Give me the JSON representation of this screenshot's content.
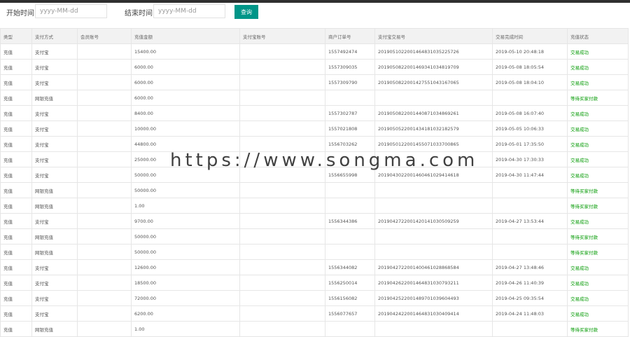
{
  "filter": {
    "start_label": "开始时间",
    "start_placeholder": "yyyy-MM-dd",
    "end_label": "结束时间",
    "end_placeholder": "yyyy-MM-dd",
    "query_button": "查询"
  },
  "table": {
    "headers": [
      "类型",
      "支付方式",
      "会员账号",
      "充值金额",
      "支付宝账号",
      "商户订单号",
      "支付宝交易号",
      "交易完成时间",
      "充值状态"
    ],
    "rows": [
      {
        "type": "充值",
        "method": "支付宝",
        "account": "",
        "amount": "15400.00",
        "alipay": "",
        "order": "1557492474",
        "trade": "2019051022001464831035225726",
        "time": "2019-05-10 20:48:18",
        "status": "交易成功",
        "status_kind": "ok"
      },
      {
        "type": "充值",
        "method": "支付宝",
        "account": "",
        "amount": "6000.00",
        "alipay": "",
        "order": "1557309035",
        "trade": "2019050822001469341034819709",
        "time": "2019-05-08 18:05:54",
        "status": "交易成功",
        "status_kind": "ok"
      },
      {
        "type": "充值",
        "method": "支付宝",
        "account": "",
        "amount": "6000.00",
        "alipay": "",
        "order": "1557309790",
        "trade": "2019050822001427551043167065",
        "time": "2019-05-08 18:04:10",
        "status": "交易成功",
        "status_kind": "ok"
      },
      {
        "type": "充值",
        "method": "网银充值",
        "account": "",
        "amount": "6000.00",
        "alipay": "",
        "order": "",
        "trade": "",
        "time": "",
        "status": "等待买家付款",
        "status_kind": "wait"
      },
      {
        "type": "充值",
        "method": "支付宝",
        "account": "",
        "amount": "8400.00",
        "alipay": "",
        "order": "1557302787",
        "trade": "2019050822001440871034869261",
        "time": "2019-05-08 16:07:40",
        "status": "交易成功",
        "status_kind": "ok"
      },
      {
        "type": "充值",
        "method": "支付宝",
        "account": "",
        "amount": "10000.00",
        "alipay": "",
        "order": "1557021808",
        "trade": "2019050522001434181032182579",
        "time": "2019-05-05 10:06:33",
        "status": "交易成功",
        "status_kind": "ok"
      },
      {
        "type": "充值",
        "method": "支付宝",
        "account": "",
        "amount": "44800.00",
        "alipay": "",
        "order": "1556703262",
        "trade": "2019050122001455071033700865",
        "time": "2019-05-01 17:35:50",
        "status": "交易成功",
        "status_kind": "ok"
      },
      {
        "type": "充值",
        "method": "支付宝",
        "account": "",
        "amount": "25000.00",
        "alipay": "",
        "order": "",
        "trade": "",
        "time": "2019-04-30 17:30:33",
        "status": "交易成功",
        "status_kind": "ok"
      },
      {
        "type": "充值",
        "method": "支付宝",
        "account": "",
        "amount": "50000.00",
        "alipay": "",
        "order": "1556655998",
        "trade": "2019043022001460461029414618",
        "time": "2019-04-30 11:47:44",
        "status": "交易成功",
        "status_kind": "ok"
      },
      {
        "type": "充值",
        "method": "网银充值",
        "account": "",
        "amount": "50000.00",
        "alipay": "",
        "order": "",
        "trade": "",
        "time": "",
        "status": "等待买家付款",
        "status_kind": "wait"
      },
      {
        "type": "充值",
        "method": "网银充值",
        "account": "",
        "amount": "1.00",
        "alipay": "",
        "order": "",
        "trade": "",
        "time": "",
        "status": "等待买家付款",
        "status_kind": "wait"
      },
      {
        "type": "充值",
        "method": "支付宝",
        "account": "",
        "amount": "9700.00",
        "alipay": "",
        "order": "1556344386",
        "trade": "2019042722001420141030509259",
        "time": "2019-04-27 13:53:44",
        "status": "交易成功",
        "status_kind": "ok"
      },
      {
        "type": "充值",
        "method": "网银充值",
        "account": "",
        "amount": "50000.00",
        "alipay": "",
        "order": "",
        "trade": "",
        "time": "",
        "status": "等待买家付款",
        "status_kind": "wait"
      },
      {
        "type": "充值",
        "method": "网银充值",
        "account": "",
        "amount": "50000.00",
        "alipay": "",
        "order": "",
        "trade": "",
        "time": "",
        "status": "等待买家付款",
        "status_kind": "wait"
      },
      {
        "type": "充值",
        "method": "支付宝",
        "account": "",
        "amount": "12600.00",
        "alipay": "",
        "order": "1556344082",
        "trade": "2019042722001400461028868584",
        "time": "2019-04-27 13:48:46",
        "status": "交易成功",
        "status_kind": "ok"
      },
      {
        "type": "充值",
        "method": "支付宝",
        "account": "",
        "amount": "18500.00",
        "alipay": "",
        "order": "1556250014",
        "trade": "2019042622001464831030793211",
        "time": "2019-04-26 11:40:39",
        "status": "交易成功",
        "status_kind": "ok"
      },
      {
        "type": "充值",
        "method": "支付宝",
        "account": "",
        "amount": "72000.00",
        "alipay": "",
        "order": "1556156082",
        "trade": "2019042522001489701039604493",
        "time": "2019-04-25 09:35:54",
        "status": "交易成功",
        "status_kind": "ok"
      },
      {
        "type": "充值",
        "method": "支付宝",
        "account": "",
        "amount": "6200.00",
        "alipay": "",
        "order": "1556077657",
        "trade": "2019042422001464831030409414",
        "time": "2019-04-24 11:48:03",
        "status": "交易成功",
        "status_kind": "ok"
      },
      {
        "type": "充值",
        "method": "网银充值",
        "account": "",
        "amount": "1.00",
        "alipay": "",
        "order": "",
        "trade": "",
        "time": "",
        "status": "等待买家付款",
        "status_kind": "wait"
      }
    ]
  },
  "watermark": "https://www.songma.com",
  "colors": {
    "accent": "#009688",
    "success": "#009900"
  }
}
